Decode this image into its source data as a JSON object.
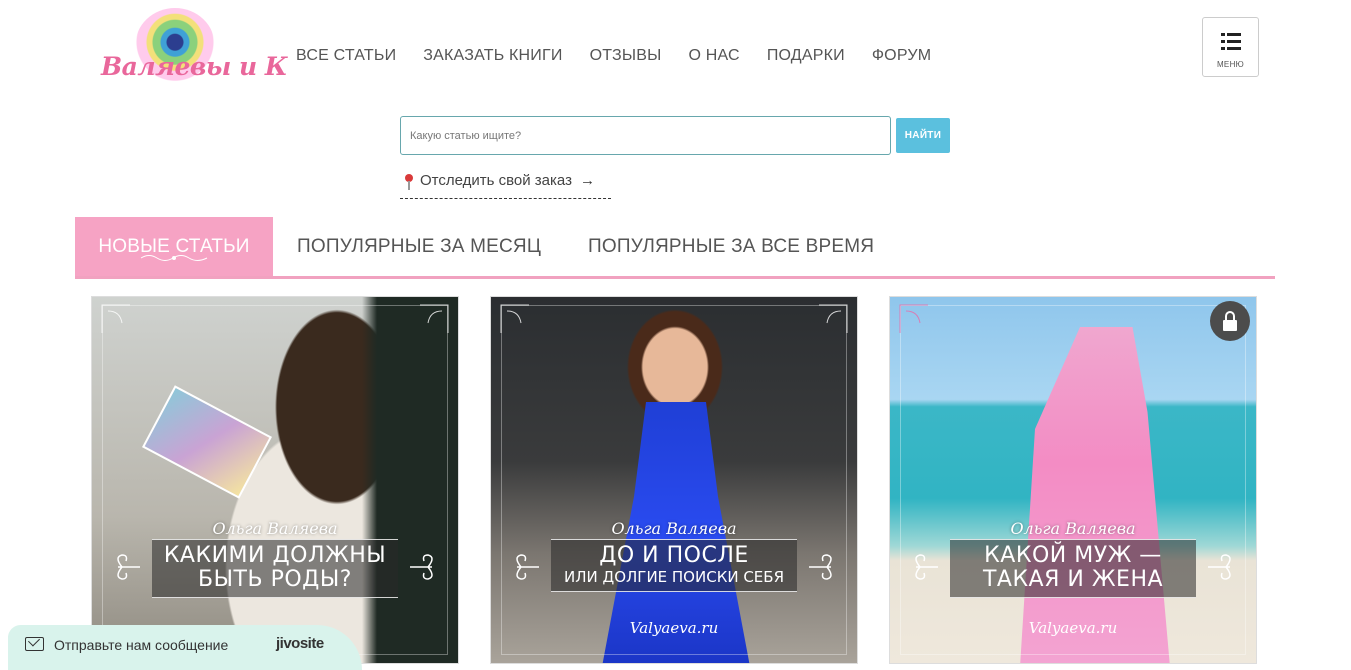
{
  "logo": {
    "text": "Валяевы и К"
  },
  "nav": [
    {
      "label": "ВСЕ СТАТЬИ"
    },
    {
      "label": "ЗАКАЗАТЬ КНИГИ"
    },
    {
      "label": "ОТЗЫВЫ"
    },
    {
      "label": "О НАС"
    },
    {
      "label": "ПОДАРКИ"
    },
    {
      "label": "ФОРУМ"
    }
  ],
  "menu": {
    "label": "МЕНЮ",
    "icon": "list-menu-icon"
  },
  "search": {
    "placeholder": "Какую статью ищите?",
    "value": "",
    "button_label": "НАЙТИ",
    "border_color": "#67a7ad",
    "button_color": "#5bc0de"
  },
  "track_order": {
    "label": "Отследить свой заказ",
    "icon": "map-pin-icon",
    "arrow": "→"
  },
  "tabs": [
    {
      "label": "НОВЫЕ СТАТЬИ",
      "active": true
    },
    {
      "label": "ПОПУЛЯРНЫЕ ЗА МЕСЯЦ",
      "active": false
    },
    {
      "label": "ПОПУЛЯРНЫЕ ЗА ВСЕ ВРЕМЯ",
      "active": false
    }
  ],
  "accent_color": "#f6a3c4",
  "cards": [
    {
      "author": "Ольга Валяева",
      "title_lines": [
        "КАКИМИ ДОЛЖНЫ",
        "БЫТЬ РОДЫ?"
      ],
      "subtitle": "",
      "watermark": "",
      "locked": false
    },
    {
      "author": "Ольга Валяева",
      "title_lines": [
        "ДО И ПОСЛЕ"
      ],
      "subtitle": "ИЛИ ДОЛГИЕ ПОИСКИ СЕБЯ",
      "watermark": "Valyaeva.ru",
      "locked": false
    },
    {
      "author": "Ольга Валяева",
      "title_lines": [
        "КАКОЙ МУЖ —",
        "ТАКАЯ И ЖЕНА"
      ],
      "subtitle": "",
      "watermark": "Valyaeva.ru",
      "locked": true
    }
  ],
  "chat_widget": {
    "text": "Отправьте нам сообщение",
    "brand": "jivosite",
    "icon": "mail-icon"
  }
}
